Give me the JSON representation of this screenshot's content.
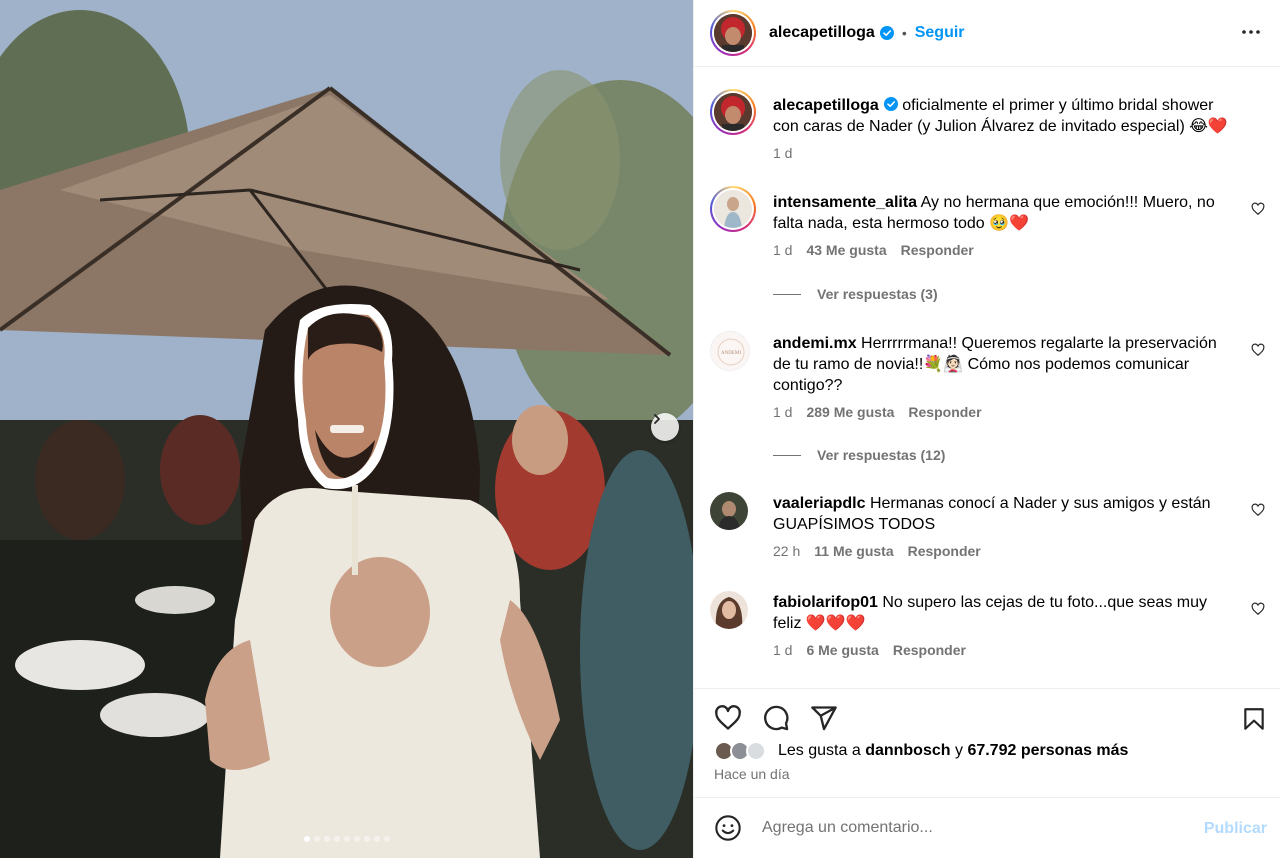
{
  "post": {
    "author": "alecapetilloga",
    "follow_label": "Seguir",
    "separator": "•",
    "caption": "oficialmente el primer y último bridal shower con caras de Nader (y Julion Álvarez de invitado especial) 😂❤️",
    "caption_time": "1 d",
    "carousel": {
      "total_slides": 9,
      "active_slide": 1
    }
  },
  "comments": [
    {
      "username": "intensamente_alita",
      "text": "Ay no hermana que emoción!!! Muero, no falta nada, esta hermoso todo 🥹❤️",
      "time": "1 d",
      "likes": "43 Me gusta",
      "reply_label": "Responder",
      "view_replies": "Ver respuestas (3)"
    },
    {
      "username": "andemi.mx",
      "text": "Herrrrrmana!! Queremos regalarte la preservación de tu ramo de novia!!💐👰🏻 Cómo nos podemos comunicar contigo??",
      "time": "1 d",
      "likes": "289 Me gusta",
      "reply_label": "Responder",
      "view_replies": "Ver respuestas (12)",
      "avatar_text": "ANDEMI"
    },
    {
      "username": "vaaleriapdlc",
      "text": "Hermanas conocí a Nader y sus amigos y están GUAPÍSIMOS TODOS",
      "time": "22 h",
      "likes": "11 Me gusta",
      "reply_label": "Responder"
    },
    {
      "username": "fabiolarifop01",
      "text": "No supero las cejas de tu foto...que seas muy feliz ❤️❤️❤️",
      "time": "1 d",
      "likes": "6 Me gusta",
      "reply_label": "Responder"
    }
  ],
  "likes_summary": {
    "prefix": "Les gusta a",
    "liker": "dannbosch",
    "connector": "y",
    "others": "67.792 personas más",
    "posted_ago": "Hace un día"
  },
  "comment_box": {
    "placeholder": "Agrega un comentario...",
    "publish_label": "Publicar"
  },
  "icons": [
    "verified-badge-icon",
    "more-options-icon",
    "heart-icon",
    "comment-icon",
    "share-icon",
    "bookmark-icon",
    "emoji-icon",
    "next-slide-icon"
  ],
  "colors": {
    "accent": "#0095f6",
    "secondary_text": "#737373",
    "publish_disabled": "#b3dbff",
    "divider": "#efefef"
  }
}
